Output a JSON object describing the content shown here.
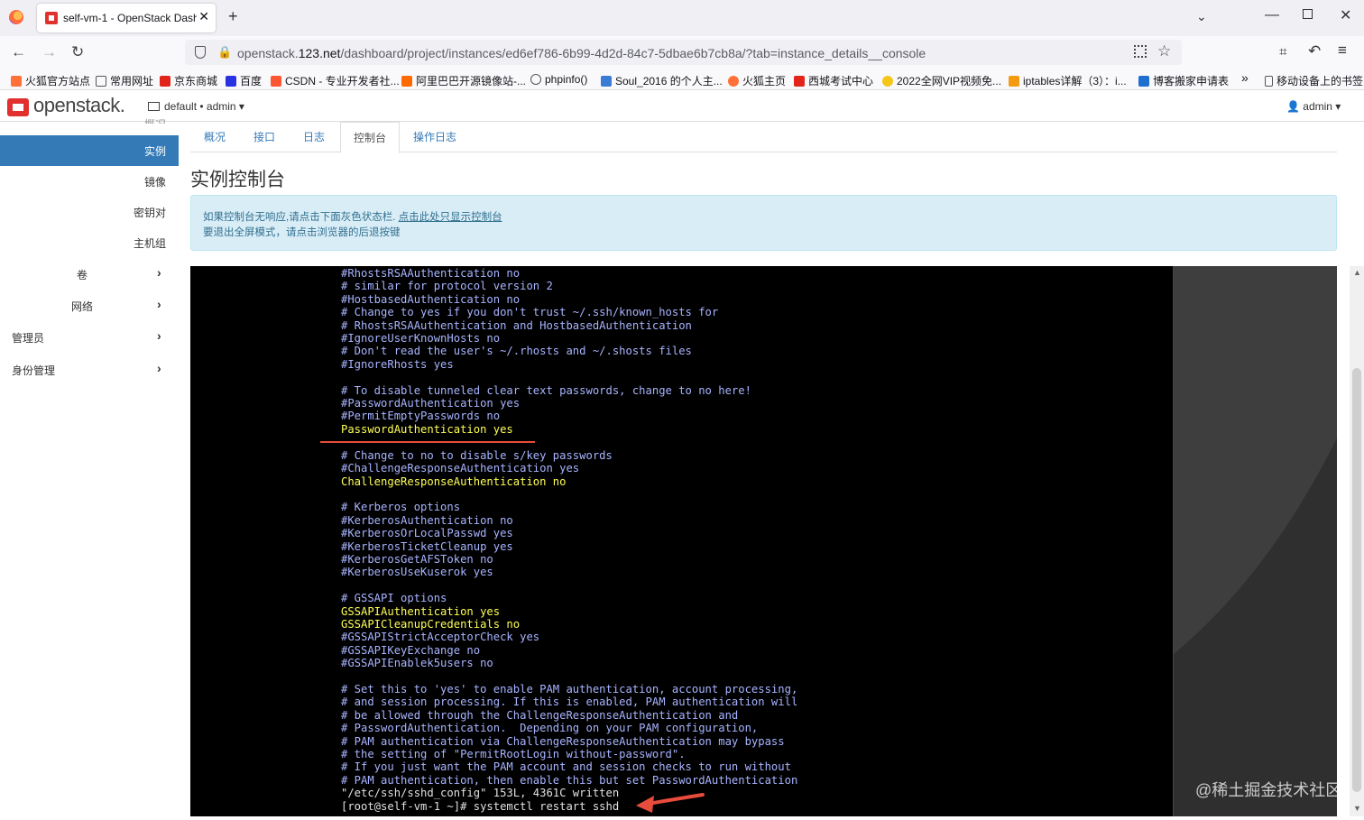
{
  "browser": {
    "tab_title": "self-vm-1 - OpenStack Dashb",
    "url_prefix": "openstack.",
    "url_domain": "123.net",
    "url_path": "/dashboard/project/instances/ed6ef786-6b99-4d2d-84c7-5dbae6b7cb8a/?tab=instance_details__console",
    "bookmarks": [
      {
        "label": "火狐官方站点",
        "color": "#ff7139"
      },
      {
        "label": "常用网址",
        "color": "#ffffff"
      },
      {
        "label": "京东商城",
        "color": "#e1251b"
      },
      {
        "label": "百度",
        "color": "#2932e1"
      },
      {
        "label": "CSDN - 专业开发者社...",
        "color": "#fc5531"
      },
      {
        "label": "阿里巴巴开源镜像站-...",
        "color": "#ff6a00"
      },
      {
        "label": "phpinfo()",
        "color": "#ffffff"
      },
      {
        "label": "Soul_2016 的个人主...",
        "color": "#3a7bd5"
      },
      {
        "label": "火狐主页",
        "color": "#ff7139"
      },
      {
        "label": "西城考试中心",
        "color": "#e1251b"
      },
      {
        "label": "2022全网VIP视频免...",
        "color": "#f5c518"
      },
      {
        "label": "iptables详解（3）：i...",
        "color": "#f39c12"
      },
      {
        "label": "博客搬家申请表",
        "color": "#1f6fd1"
      }
    ],
    "bookmarks_overflow": "»",
    "mobile_bookmarks": "移动设备上的书签"
  },
  "header": {
    "logo": "openstack.",
    "project": "default • admin ▾",
    "user": "👤 admin ▾"
  },
  "sidebar": {
    "partial_top": "概况",
    "items": [
      {
        "label": "实例",
        "active": true
      },
      {
        "label": "镜像"
      },
      {
        "label": "密钥对"
      },
      {
        "label": "主机组"
      },
      {
        "label": "卷",
        "chevron": "›"
      },
      {
        "label": "网络",
        "chevron": "›"
      },
      {
        "label": "管理员",
        "chevron": "›"
      },
      {
        "label": "身份管理",
        "chevron": "›"
      }
    ]
  },
  "tabs": [
    "概况",
    "接口",
    "日志",
    "控制台",
    "操作日志"
  ],
  "active_tab": "控制台",
  "page_title": "实例控制台",
  "info": {
    "line1": "如果控制台无响应,请点击下面灰色状态栏.",
    "link": "点击此处只显示控制台",
    "line2": "要退出全屏模式，请点击浏览器的后退按键"
  },
  "console_lines": [
    {
      "text": "#RhostsRSAAuthentication no"
    },
    {
      "text": "# similar for protocol version 2"
    },
    {
      "text": "#HostbasedAuthentication no"
    },
    {
      "text": "# Change to yes if you don't trust ~/.ssh/known_hosts for"
    },
    {
      "text": "# RhostsRSAAuthentication and HostbasedAuthentication"
    },
    {
      "text": "#IgnoreUserKnownHosts no"
    },
    {
      "text": "# Don't read the user's ~/.rhosts and ~/.shosts files"
    },
    {
      "text": "#IgnoreRhosts yes"
    },
    {
      "text": ""
    },
    {
      "text": "# To disable tunneled clear text passwords, change to no here!"
    },
    {
      "text": "#PasswordAuthentication yes"
    },
    {
      "text": "#PermitEmptyPasswords no"
    },
    {
      "text": "PasswordAuthentication yes",
      "hl": true
    },
    {
      "text": ""
    },
    {
      "text": "# Change to no to disable s/key passwords"
    },
    {
      "text": "#ChallengeResponseAuthentication yes"
    },
    {
      "text": "ChallengeResponseAuthentication no",
      "hl": true
    },
    {
      "text": ""
    },
    {
      "text": "# Kerberos options"
    },
    {
      "text": "#KerberosAuthentication no"
    },
    {
      "text": "#KerberosOrLocalPasswd yes"
    },
    {
      "text": "#KerberosTicketCleanup yes"
    },
    {
      "text": "#KerberosGetAFSToken no"
    },
    {
      "text": "#KerberosUseKuserok yes"
    },
    {
      "text": ""
    },
    {
      "text": "# GSSAPI options"
    },
    {
      "text": "GSSAPIAuthentication yes",
      "hl": true
    },
    {
      "text": "GSSAPICleanupCredentials no",
      "hl": true
    },
    {
      "text": "#GSSAPIStrictAcceptorCheck yes"
    },
    {
      "text": "#GSSAPIKeyExchange no"
    },
    {
      "text": "#GSSAPIEnablek5users no"
    },
    {
      "text": ""
    },
    {
      "text": "# Set this to 'yes' to enable PAM authentication, account processing,"
    },
    {
      "text": "# and session processing. If this is enabled, PAM authentication will"
    },
    {
      "text": "# be allowed through the ChallengeResponseAuthentication and"
    },
    {
      "text": "# PasswordAuthentication.  Depending on your PAM configuration,"
    },
    {
      "text": "# PAM authentication via ChallengeResponseAuthentication may bypass"
    },
    {
      "text": "# the setting of \"PermitRootLogin without-password\"."
    },
    {
      "text": "# If you just want the PAM account and session checks to run without"
    },
    {
      "text": "# PAM authentication, then enable this but set PasswordAuthentication"
    },
    {
      "text": "\"/etc/ssh/sshd_config\" 153L, 4361C written",
      "w": true
    },
    {
      "text": "[root@self-vm-1 ~]# systemctl restart sshd",
      "w": true
    }
  ],
  "watermark": "@稀土掘金技术社区",
  "colors": {
    "accent": "#337ab7",
    "term_text": "#a8b4ff",
    "term_highlight": "#ffff55",
    "annotation": "#e74c3c"
  }
}
